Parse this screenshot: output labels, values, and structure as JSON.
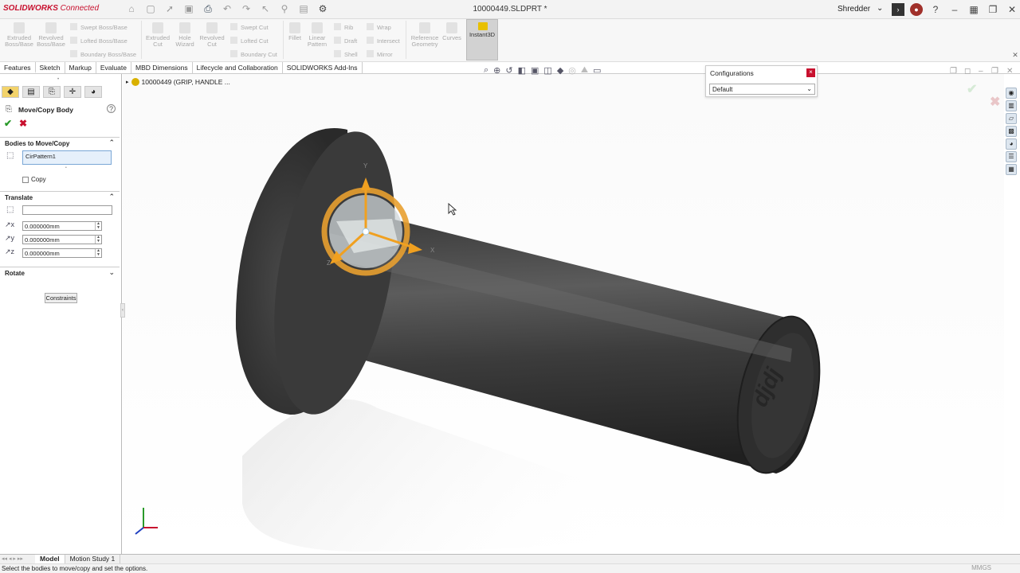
{
  "app": {
    "logo_brand": "SOLIDWORKS",
    "logo_suffix": "Connected",
    "doc_title": "10000449.SLDPRT *",
    "user": "Shredder"
  },
  "ribbon": {
    "buttons": [
      "Extruded Boss/Base",
      "Revolved Boss/Base",
      "Extruded Cut",
      "Hole Wizard",
      "Revolved Cut",
      "Fillet",
      "Linear Pattern",
      "Reference Geometry",
      "Curves"
    ],
    "small_1": [
      "Swept Boss/Base",
      "Lofted Boss/Base",
      "Boundary Boss/Base"
    ],
    "small_2": [
      "Swept Cut",
      "Lofted Cut",
      "Boundary Cut"
    ],
    "small_3": [
      "Rib",
      "Draft",
      "Shell"
    ],
    "small_4": [
      "Wrap",
      "Intersect",
      "Mirror"
    ],
    "instant3d": "Instant3D"
  },
  "tabs": [
    "Features",
    "Sketch",
    "Markup",
    "Evaluate",
    "MBD Dimensions",
    "Lifecycle and Collaboration",
    "SOLIDWORKS Add-Ins"
  ],
  "property_manager": {
    "title": "Move/Copy Body",
    "sec_bodies": "Bodies to Move/Copy",
    "selected_body": "CirPattern1",
    "copy_label": "Copy",
    "sec_translate": "Translate",
    "dx": "0.000000mm",
    "dy": "0.000000mm",
    "dz": "0.000000mm",
    "sec_rotate": "Rotate",
    "constraints_label": "Constraints"
  },
  "tree": {
    "root": "10000449 (GRIP, HANDLE ..."
  },
  "configurations": {
    "title": "Configurations",
    "selected": "Default"
  },
  "triad": {
    "x": "X",
    "y": "Y",
    "z": "Z"
  },
  "bottom_tabs": [
    "Model",
    "Motion Study 1"
  ],
  "status": {
    "message": "Select the bodies to move/copy and set the options.",
    "units": "MMGS"
  },
  "colors": {
    "accent": "#c8102e",
    "triad": "#f0a020",
    "part": "#4a4a4a"
  }
}
